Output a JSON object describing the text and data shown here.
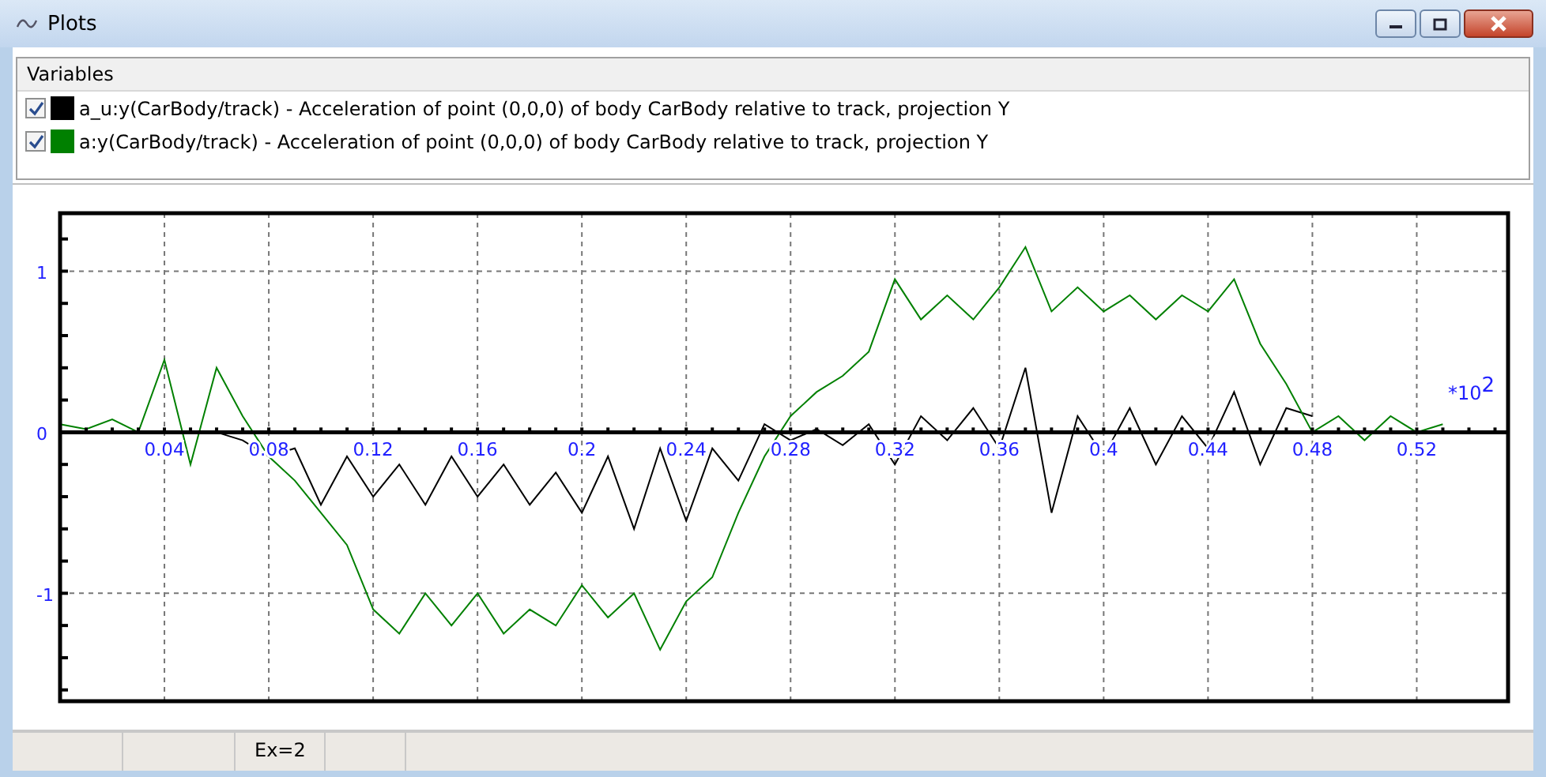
{
  "window": {
    "title": "Plots"
  },
  "variables": {
    "header": "Variables",
    "items": [
      {
        "label": "a_u:y(CarBody/track) - Acceleration of point (0,0,0) of body CarBody relative to track, projection Y",
        "checked": true,
        "color": "#000000"
      },
      {
        "label": "a:y(CarBody/track) - Acceleration of point (0,0,0) of body CarBody relative to track, projection Y",
        "checked": true,
        "color": "#008000"
      }
    ]
  },
  "plot": {
    "axis_multiplier": "*10$^{2}$",
    "chart_data": {
      "type": "line",
      "x": [
        0,
        0.01,
        0.02,
        0.03,
        0.04,
        0.05,
        0.06,
        0.07,
        0.08,
        0.09,
        0.1,
        0.11,
        0.12,
        0.13,
        0.14,
        0.15,
        0.16,
        0.17,
        0.18,
        0.19,
        0.2,
        0.21,
        0.22,
        0.23,
        0.24,
        0.25,
        0.26,
        0.27,
        0.28,
        0.29,
        0.3,
        0.31,
        0.32,
        0.33,
        0.34,
        0.35,
        0.36,
        0.37,
        0.38,
        0.39,
        0.4,
        0.41,
        0.42,
        0.43,
        0.44,
        0.45,
        0.46,
        0.47,
        0.48,
        0.49,
        0.5,
        0.51,
        0.52,
        0.53
      ],
      "series": [
        {
          "color": "#000000",
          "values": [
            0,
            0,
            0,
            0,
            0,
            0,
            0,
            -0.05,
            -0.15,
            -0.1,
            -0.45,
            -0.15,
            -0.4,
            -0.2,
            -0.45,
            -0.15,
            -0.4,
            -0.2,
            -0.45,
            -0.25,
            -0.5,
            -0.15,
            -0.6,
            -0.1,
            -0.55,
            -0.1,
            -0.3,
            0.05,
            -0.05,
            0.02,
            -0.08,
            0.05,
            -0.2,
            0.1,
            -0.05,
            0.15,
            -0.1,
            0.4,
            -0.5,
            0.1,
            -0.15,
            0.15,
            -0.2,
            0.1,
            -0.1,
            0.25,
            -0.2,
            0.15,
            0.1,
            null,
            null,
            null,
            null,
            null
          ]
        },
        {
          "color": "#008000",
          "values": [
            0.05,
            0.02,
            0.08,
            0,
            0.45,
            -0.2,
            0.4,
            0.1,
            -0.15,
            -0.3,
            -0.5,
            -0.7,
            -1.1,
            -1.25,
            -1,
            -1.2,
            -1,
            -1.25,
            -1.1,
            -1.2,
            -0.95,
            -1.15,
            -1,
            -1.35,
            -1.05,
            -0.9,
            -0.5,
            -0.15,
            0.1,
            0.25,
            0.35,
            0.5,
            0.95,
            0.7,
            0.85,
            0.7,
            0.9,
            1.15,
            0.75,
            0.9,
            0.75,
            0.85,
            0.7,
            0.85,
            0.75,
            0.95,
            0.55,
            0.3,
            0,
            0.1,
            -0.05,
            0.1,
            0,
            0.05
          ]
        }
      ],
      "xlim": [
        0,
        0.555
      ],
      "ylim": [
        -1.67,
        1.36
      ],
      "xticks": [
        0.04,
        0.08,
        0.12,
        0.16,
        0.2,
        0.24,
        0.28,
        0.32,
        0.36,
        0.4,
        0.44,
        0.48,
        0.52
      ],
      "yticks": [
        -1,
        0,
        1
      ],
      "grid": true
    }
  },
  "status_bar": {
    "cells": [
      "Ex=2"
    ]
  }
}
